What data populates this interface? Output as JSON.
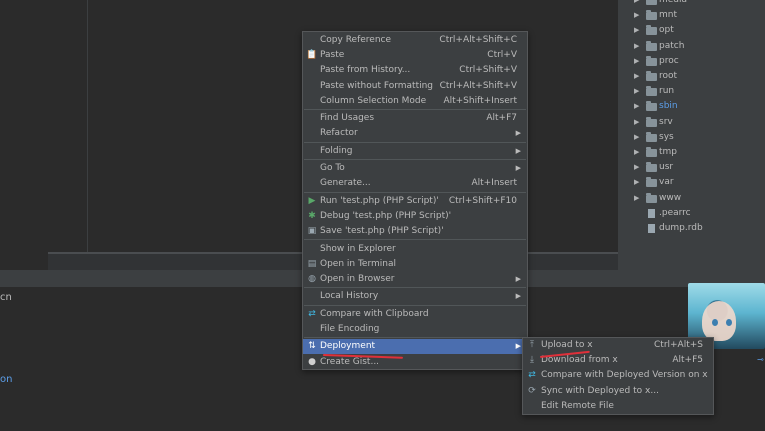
{
  "project_tree": {
    "items": [
      {
        "label": "media",
        "type": "folder",
        "color": "#bbbbbb"
      },
      {
        "label": "mnt",
        "type": "folder",
        "color": "#bbbbbb"
      },
      {
        "label": "opt",
        "type": "folder",
        "color": "#bbbbbb"
      },
      {
        "label": "patch",
        "type": "folder",
        "color": "#bbbbbb"
      },
      {
        "label": "proc",
        "type": "folder",
        "color": "#bbbbbb"
      },
      {
        "label": "root",
        "type": "folder",
        "color": "#bbbbbb"
      },
      {
        "label": "run",
        "type": "folder",
        "color": "#bbbbbb"
      },
      {
        "label": "sbin",
        "type": "folder",
        "color": "#5c9ee8"
      },
      {
        "label": "srv",
        "type": "folder",
        "color": "#bbbbbb"
      },
      {
        "label": "sys",
        "type": "folder",
        "color": "#bbbbbb"
      },
      {
        "label": "tmp",
        "type": "folder",
        "color": "#bbbbbb"
      },
      {
        "label": "usr",
        "type": "folder",
        "color": "#bbbbbb"
      },
      {
        "label": "var",
        "type": "folder",
        "color": "#bbbbbb"
      },
      {
        "label": "www",
        "type": "folder",
        "color": "#bbbbbb"
      },
      {
        "label": ".pearrc",
        "type": "file",
        "color": "#bbbbbb"
      },
      {
        "label": "dump.rdb",
        "type": "file",
        "color": "#bbbbbb"
      }
    ]
  },
  "bottom_panel": {
    "text_1": "cn",
    "text_2": "on"
  },
  "context_menu": {
    "items": [
      {
        "label": "Copy Reference",
        "shortcut": "Ctrl+Alt+Shift+C"
      },
      {
        "label": "Paste",
        "shortcut": "Ctrl+V",
        "icon": "clipboard-icon"
      },
      {
        "label": "Paste from History...",
        "shortcut": "Ctrl+Shift+V"
      },
      {
        "label": "Paste without Formatting",
        "shortcut": "Ctrl+Alt+Shift+V"
      },
      {
        "label": "Column Selection Mode",
        "shortcut": "Alt+Shift+Insert"
      },
      {
        "separator": true
      },
      {
        "label": "Find Usages",
        "shortcut": "Alt+F7"
      },
      {
        "label": "Refactor",
        "submenu": true
      },
      {
        "separator": true
      },
      {
        "label": "Folding",
        "submenu": true
      },
      {
        "separator": true
      },
      {
        "label": "Go To",
        "submenu": true
      },
      {
        "label": "Generate...",
        "shortcut": "Alt+Insert"
      },
      {
        "separator": true
      },
      {
        "label": "Run 'test.php (PHP Script)'",
        "shortcut": "Ctrl+Shift+F10",
        "icon": "run-icon"
      },
      {
        "label": "Debug 'test.php (PHP Script)'",
        "icon": "debug-icon"
      },
      {
        "label": "Save 'test.php (PHP Script)'",
        "icon": "save-icon"
      },
      {
        "separator": true
      },
      {
        "label": "Show in Explorer"
      },
      {
        "label": "Open in Terminal",
        "icon": "terminal-icon"
      },
      {
        "label": "Open in Browser",
        "submenu": true,
        "icon": "globe-icon"
      },
      {
        "separator": true
      },
      {
        "label": "Local History",
        "submenu": true
      },
      {
        "separator": true
      },
      {
        "label": "Compare with Clipboard",
        "icon": "compare-icon"
      },
      {
        "label": "File Encoding"
      },
      {
        "separator": true
      },
      {
        "label": "Deployment",
        "submenu": true,
        "selected": true,
        "icon": "deployment-icon"
      },
      {
        "label": "Create Gist...",
        "icon": "github-icon"
      }
    ]
  },
  "deployment_submenu": {
    "items": [
      {
        "label": "Upload to x",
        "shortcut": "Ctrl+Alt+S",
        "icon": "upload-icon"
      },
      {
        "label": "Download from x",
        "shortcut": "Alt+F5",
        "icon": "download-icon"
      },
      {
        "label": "Compare with Deployed Version on x",
        "icon": "compare-icon"
      },
      {
        "label": "Sync with Deployed to x...",
        "icon": "sync-icon"
      },
      {
        "label": "Edit Remote File"
      }
    ]
  },
  "colors": {
    "selection": "#4b6eaf",
    "annotation_mark": "#e0303a",
    "link": "#5c9ee8"
  }
}
